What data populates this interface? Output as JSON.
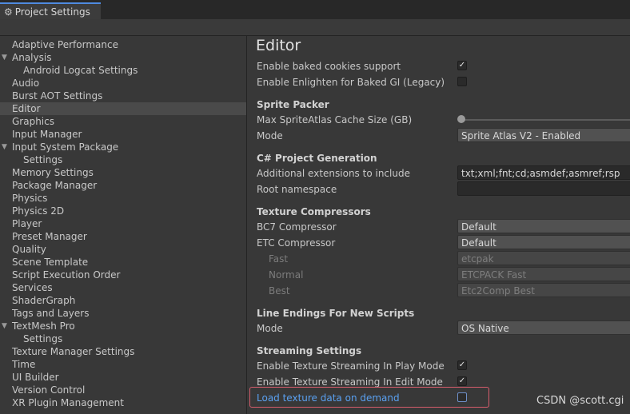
{
  "window": {
    "tab_title": "Project Settings",
    "tab_icon": "gear-icon"
  },
  "sidebar": {
    "items": [
      {
        "label": "Adaptive Performance"
      },
      {
        "label": "Analysis",
        "expanded": true
      },
      {
        "label": "Android Logcat Settings"
      },
      {
        "label": "Audio"
      },
      {
        "label": "Burst AOT Settings"
      },
      {
        "label": "Editor",
        "selected": true
      },
      {
        "label": "Graphics"
      },
      {
        "label": "Input Manager"
      },
      {
        "label": "Input System Package",
        "expanded": true
      },
      {
        "label": "Settings"
      },
      {
        "label": "Memory Settings"
      },
      {
        "label": "Package Manager"
      },
      {
        "label": "Physics"
      },
      {
        "label": "Physics 2D"
      },
      {
        "label": "Player"
      },
      {
        "label": "Preset Manager"
      },
      {
        "label": "Quality"
      },
      {
        "label": "Scene Template"
      },
      {
        "label": "Script Execution Order"
      },
      {
        "label": "Services"
      },
      {
        "label": "ShaderGraph"
      },
      {
        "label": "Tags and Layers"
      },
      {
        "label": "TextMesh Pro",
        "expanded": true
      },
      {
        "label": "Settings"
      },
      {
        "label": "Texture Manager Settings"
      },
      {
        "label": "Time"
      },
      {
        "label": "UI Builder"
      },
      {
        "label": "Version Control"
      },
      {
        "label": "XR Plugin Management"
      }
    ]
  },
  "main": {
    "title": "Editor",
    "baked_cookies": {
      "label": "Enable baked cookies support",
      "checked": true
    },
    "enlighten": {
      "label": "Enable Enlighten for Baked GI (Legacy)",
      "checked": false
    },
    "sprite_packer": {
      "header": "Sprite Packer",
      "cache_label": "Max SpriteAtlas Cache Size (GB)",
      "cache_value": 0,
      "mode_label": "Mode",
      "mode_value": "Sprite Atlas V2 - Enabled"
    },
    "csharp": {
      "header": "C# Project Generation",
      "ext_label": "Additional extensions to include",
      "ext_value": "txt;xml;fnt;cd;asmdef;asmref;rsp",
      "ns_label": "Root namespace",
      "ns_value": ""
    },
    "texture_compressors": {
      "header": "Texture Compressors",
      "bc7_label": "BC7 Compressor",
      "bc7_value": "Default",
      "etc_label": "ETC Compressor",
      "etc_value": "Default",
      "fast_label": "Fast",
      "fast_value": "etcpak",
      "normal_label": "Normal",
      "normal_value": "ETCPACK Fast",
      "best_label": "Best",
      "best_value": "Etc2Comp Best"
    },
    "line_endings": {
      "header": "Line Endings For New Scripts",
      "mode_label": "Mode",
      "mode_value": "OS Native"
    },
    "streaming": {
      "header": "Streaming Settings",
      "play_label": "Enable Texture Streaming In Play Mode",
      "play_checked": true,
      "edit_label": "Enable Texture Streaming In Edit Mode",
      "edit_checked": true,
      "demand_label": "Load texture data on demand",
      "demand_checked": false
    },
    "colors": {
      "highlight_border": "#d55c6c",
      "link_text": "#5aa0f0"
    }
  },
  "watermark": "CSDN @scott.cgi"
}
